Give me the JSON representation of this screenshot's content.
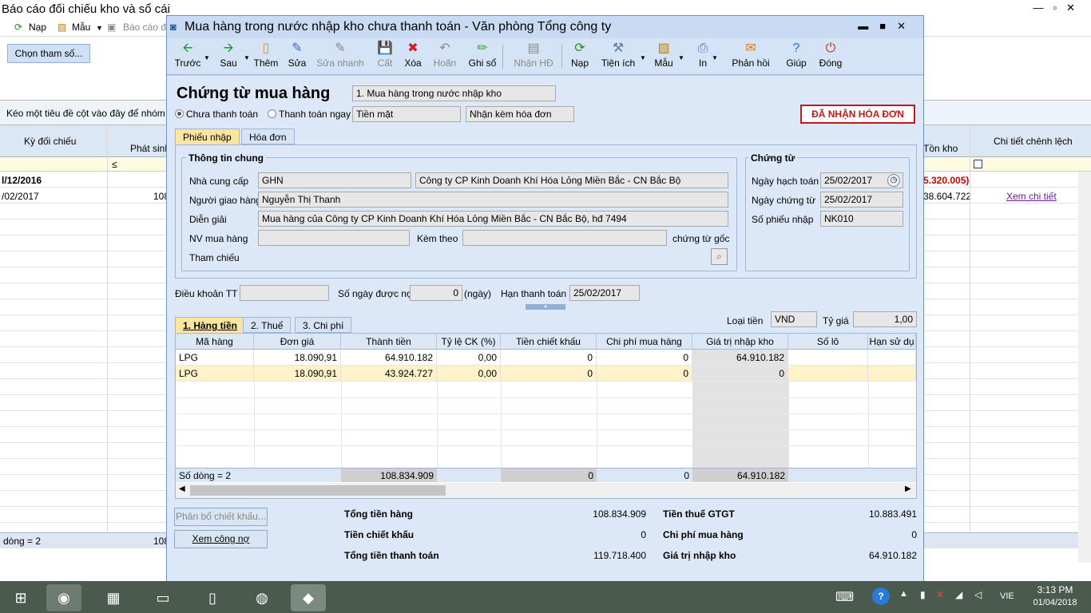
{
  "bg": {
    "title": "Báo cáo đối chiếu kho và sổ cái",
    "toolbar": {
      "nap": "Nạp",
      "mau": "Mẫu",
      "baocao": "Báo cáo đ"
    },
    "btn_chon": "Chọn tham số...",
    "group_hint": "Kéo một tiêu đề cột vào đây để nhóm",
    "col_ky": "Kỳ đối chiếu",
    "col_phatsinh": "Phát sinh",
    "col_tonkho": "Tồn kho",
    "col_chitiet": "Chi tiết chênh lệch",
    "filter_op": "≤",
    "row1_ky": "l/12/2016",
    "row1_tonkho": "5.320.005)",
    "row2_ky": "/02/2017",
    "row2_phatsinh": "108",
    "row2_tonkho": "38.604.722",
    "row2_link": "Xem chi tiết",
    "foot_count": "dòng = 2",
    "foot_val": "108"
  },
  "dialog": {
    "title": "Mua hàng trong nước nhập kho chưa thanh toán - Văn phòng Tổng công ty",
    "toolbar": [
      "Trước",
      "Sau",
      "Thêm",
      "Sửa",
      "Sửa nhanh",
      "Cất",
      "Xóa",
      "Hoãn",
      "Ghi sổ",
      "Nhận HĐ",
      "Nạp",
      "Tiện ích",
      "Mẫu",
      "In",
      "Phản hồi",
      "Giúp",
      "Đóng"
    ],
    "heading": "Chứng từ mua hàng",
    "type_value": "1. Mua hàng trong nước nhập kho",
    "radio_chua": "Chưa thanh toán",
    "radio_ngay": "Thanh toán ngay",
    "pay_method": "Tiền mặt",
    "invoice_opt": "Nhận kèm hóa đơn",
    "stamp": "ĐÃ NHẬN HÓA ĐƠN",
    "tab_phieunhap": "Phiếu nhập",
    "tab_hoadon": "Hóa đơn",
    "grp_chung": "Thông tin chung",
    "lbl_ncc": "Nhà cung cấp",
    "ncc_code": "GHN",
    "ncc_name": "Công ty CP Kinh Doanh Khí Hóa Lỏng Miền Bắc - CN Bắc Bộ",
    "lbl_nguoigiao": "Người giao hàng",
    "nguoigiao": "Nguyễn Thị Thanh",
    "lbl_diengiai": "Diễn giải",
    "diengiai": "Mua hàng của Công ty CP Kinh Doanh Khí Hóa Lỏng Miền Bắc - CN Bắc Bộ, hđ 7494",
    "lbl_nvmua": "NV mua hàng",
    "lbl_kemtheo": "Kèm theo",
    "lbl_ctgoc": "chứng từ gốc",
    "lbl_thamchieu": "Tham chiếu",
    "grp_chungtu": "Chứng từ",
    "lbl_ngayht": "Ngày hạch toán",
    "ngayht": "25/02/2017",
    "lbl_ngayct": "Ngày chứng từ",
    "ngayct": "25/02/2017",
    "lbl_sophieu": "Số phiếu nhập",
    "sophieu": "NK010",
    "lbl_dieukhoan": "Điều khoản TT",
    "lbl_songay": "Số ngày được nợ",
    "songay": "0",
    "lbl_ngay_unit": "(ngày)",
    "lbl_han": "Hạn thanh toán",
    "han": "25/02/2017",
    "subtab1": "1. Hàng tiền",
    "subtab2": "2. Thuế",
    "subtab3": "3. Chi phí",
    "lbl_loaitien": "Loại tiền",
    "loaitien": "VND",
    "lbl_tygia": "Tỷ giá",
    "tygia": "1,00",
    "cols": [
      "Mã hàng",
      "Đơn giá",
      "Thành tiền",
      "Tỷ lệ CK (%)",
      "Tiền chiết khấu",
      "Chi phí mua hàng",
      "Giá trị nhập kho",
      "Số lô",
      "Hạn sử dụ"
    ],
    "rows": [
      [
        "LPG",
        "18.090,91",
        "64.910.182",
        "0,00",
        "0",
        "0",
        "64.910.182",
        "",
        ""
      ],
      [
        "LPG",
        "18.090,91",
        "43.924.727",
        "0,00",
        "0",
        "0",
        "0",
        "",
        ""
      ]
    ],
    "foot_count": "Số dòng = 2",
    "foot_thanhtien": "108.834.909",
    "foot_ck": "0",
    "foot_cp": "0",
    "foot_gt": "64.910.182",
    "btn_phanbo": "Phân bổ chiết khấu...",
    "btn_xemcongno": "Xem công nợ",
    "lbl_tongtienhang": "Tổng tiền hàng",
    "tongtienhang": "108.834.909",
    "lbl_tienck": "Tiền chiết khấu",
    "tienck": "0",
    "lbl_tongtt": "Tổng tiền thanh toán",
    "tongtt": "119.718.400",
    "lbl_thue": "Tiền thuế GTGT",
    "thue": "10.883.491",
    "lbl_cpmua": "Chi phí mua hàng",
    "cpmua": "0",
    "lbl_gtnk": "Giá trị nhập kho",
    "gtnk": "64.910.182"
  },
  "taskbar": {
    "lang": "VIE",
    "time": "3:13 PM",
    "date": "01/04/2018"
  }
}
